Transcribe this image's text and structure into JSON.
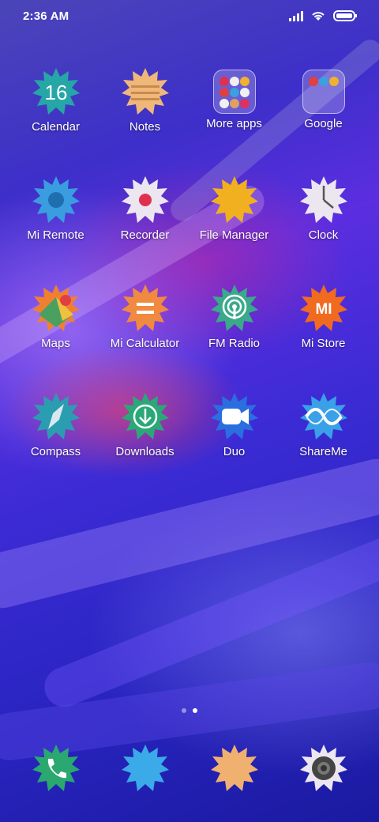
{
  "status_bar": {
    "time": "2:36 AM"
  },
  "apps": [
    {
      "label": "Calendar",
      "icon": "calendar-icon",
      "color": "#26a6a6",
      "glyph": "16"
    },
    {
      "label": "Notes",
      "icon": "notes-icon",
      "color": "#f0b878"
    },
    {
      "label": "More apps",
      "icon": "folder-icon"
    },
    {
      "label": "Google",
      "icon": "folder-icon"
    },
    {
      "label": "Mi Remote",
      "icon": "remote-icon",
      "color": "#3a9de0"
    },
    {
      "label": "Recorder",
      "icon": "recorder-icon",
      "color": "#ece6f0"
    },
    {
      "label": "File Manager",
      "icon": "file-manager-icon",
      "color": "#f0b020"
    },
    {
      "label": "Clock",
      "icon": "clock-icon",
      "color": "#ece6f0"
    },
    {
      "label": "Maps",
      "icon": "maps-icon",
      "color": "#f08030"
    },
    {
      "label": "Mi Calculator",
      "icon": "calculator-icon",
      "color": "#f08a40"
    },
    {
      "label": "FM Radio",
      "icon": "radio-icon",
      "color": "#3aaa8a"
    },
    {
      "label": "Mi Store",
      "icon": "store-icon",
      "color": "#f06a20",
      "glyph": "MI"
    },
    {
      "label": "Compass",
      "icon": "compass-icon",
      "color": "#2a9db0"
    },
    {
      "label": "Downloads",
      "icon": "downloads-icon",
      "color": "#2aa878"
    },
    {
      "label": "Duo",
      "icon": "duo-icon",
      "color": "#2a6ee0"
    },
    {
      "label": "ShareMe",
      "icon": "shareme-icon",
      "color": "#3aa0e8"
    }
  ],
  "dock": [
    {
      "icon": "phone-icon",
      "color": "#2aa870"
    },
    {
      "icon": "messaging-icon",
      "color": "#3aaae8"
    },
    {
      "icon": "browser-icon",
      "color": "#f0b070"
    },
    {
      "icon": "camera-icon",
      "color": "#ece6f0"
    }
  ],
  "page_indicator": {
    "pages": 2,
    "current": 2
  }
}
